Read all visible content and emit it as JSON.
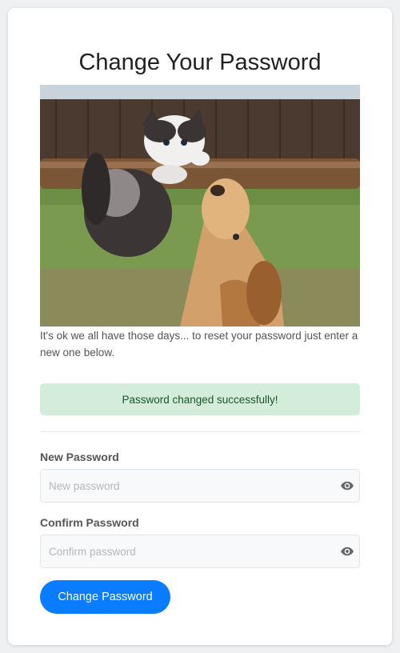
{
  "page": {
    "title": "Change Your Password",
    "intro_text": "It's ok we all have those days... to reset your password just enter a new one below."
  },
  "alert": {
    "message": "Password changed successfully!",
    "color": "#d4edda"
  },
  "form": {
    "new_password": {
      "label": "New Password",
      "placeholder": "New password",
      "value": ""
    },
    "confirm_password": {
      "label": "Confirm Password",
      "placeholder": "Confirm password",
      "value": ""
    },
    "toggle_icon": "eye-icon",
    "submit_label": "Change Password"
  },
  "colors": {
    "primary": "#0a7cff",
    "success_bg": "#d4edda",
    "success_text": "#155724"
  }
}
